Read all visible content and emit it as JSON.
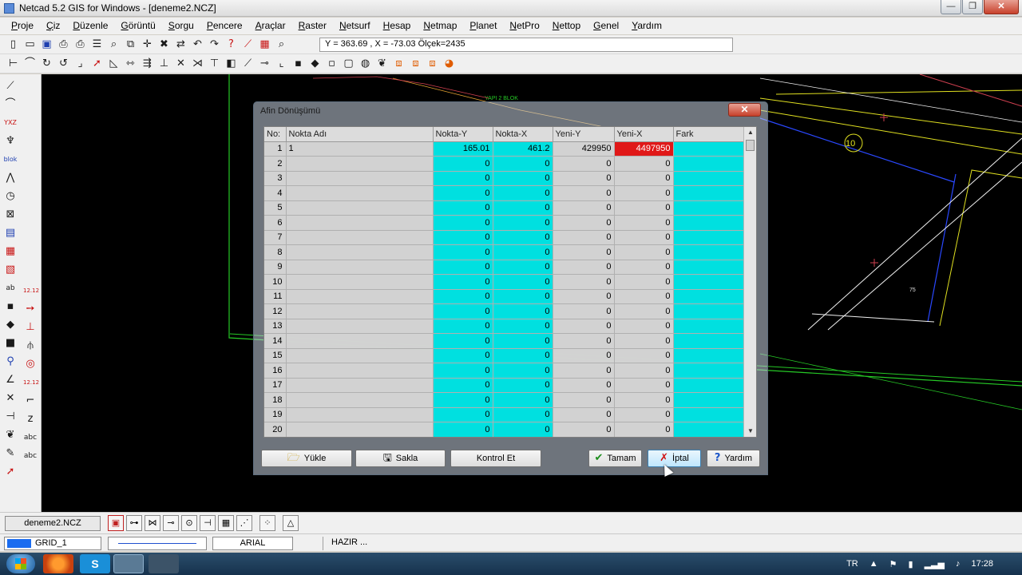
{
  "window": {
    "title": "Netcad 5.2 GIS for Windows - [deneme2.NCZ]",
    "minimize": "—",
    "maximize": "❐",
    "close": "✕"
  },
  "menu": [
    "Proje",
    "Çiz",
    "Düzenle",
    "Görüntü",
    "Sorgu",
    "Pencere",
    "Araçlar",
    "Raster",
    "Netsurf",
    "Hesap",
    "Netmap",
    "Planet",
    "NetPro",
    "Nettop",
    "Genel",
    "Yardım"
  ],
  "coord_readout": "Y = 363.69 , X = -73.03  Ölçek=2435",
  "left_toolbar": {
    "yxz_label": "YXZ",
    "blok_label": "blok",
    "ab_label": "ab",
    "num_label_1": "12.12",
    "num_label_2": "12.12",
    "abc_label_1": "abc",
    "abc_label_2": "abc"
  },
  "canvas": {
    "label_10": "10",
    "label_75": "75",
    "label_blok": "YAPI 2 BLOK"
  },
  "dialog": {
    "title": "Afin Dönüşümü",
    "close": "✕",
    "columns": [
      "No:",
      "Nokta Adı",
      "Nokta-Y",
      "Nokta-X",
      "Yeni-Y",
      "Yeni-X",
      "Fark"
    ],
    "rows": [
      {
        "no": "1",
        "name": "1",
        "nokta_y": "165.01",
        "nokta_x": "461.2",
        "yeni_y": "429950",
        "yeni_x": "4497950",
        "fark": ""
      },
      {
        "no": "2",
        "name": "",
        "nokta_y": "0",
        "nokta_x": "0",
        "yeni_y": "0",
        "yeni_x": "0",
        "fark": ""
      },
      {
        "no": "3",
        "name": "",
        "nokta_y": "0",
        "nokta_x": "0",
        "yeni_y": "0",
        "yeni_x": "0",
        "fark": ""
      },
      {
        "no": "4",
        "name": "",
        "nokta_y": "0",
        "nokta_x": "0",
        "yeni_y": "0",
        "yeni_x": "0",
        "fark": ""
      },
      {
        "no": "5",
        "name": "",
        "nokta_y": "0",
        "nokta_x": "0",
        "yeni_y": "0",
        "yeni_x": "0",
        "fark": ""
      },
      {
        "no": "6",
        "name": "",
        "nokta_y": "0",
        "nokta_x": "0",
        "yeni_y": "0",
        "yeni_x": "0",
        "fark": ""
      },
      {
        "no": "7",
        "name": "",
        "nokta_y": "0",
        "nokta_x": "0",
        "yeni_y": "0",
        "yeni_x": "0",
        "fark": ""
      },
      {
        "no": "8",
        "name": "",
        "nokta_y": "0",
        "nokta_x": "0",
        "yeni_y": "0",
        "yeni_x": "0",
        "fark": ""
      },
      {
        "no": "9",
        "name": "",
        "nokta_y": "0",
        "nokta_x": "0",
        "yeni_y": "0",
        "yeni_x": "0",
        "fark": ""
      },
      {
        "no": "10",
        "name": "",
        "nokta_y": "0",
        "nokta_x": "0",
        "yeni_y": "0",
        "yeni_x": "0",
        "fark": ""
      },
      {
        "no": "11",
        "name": "",
        "nokta_y": "0",
        "nokta_x": "0",
        "yeni_y": "0",
        "yeni_x": "0",
        "fark": ""
      },
      {
        "no": "12",
        "name": "",
        "nokta_y": "0",
        "nokta_x": "0",
        "yeni_y": "0",
        "yeni_x": "0",
        "fark": ""
      },
      {
        "no": "13",
        "name": "",
        "nokta_y": "0",
        "nokta_x": "0",
        "yeni_y": "0",
        "yeni_x": "0",
        "fark": ""
      },
      {
        "no": "14",
        "name": "",
        "nokta_y": "0",
        "nokta_x": "0",
        "yeni_y": "0",
        "yeni_x": "0",
        "fark": ""
      },
      {
        "no": "15",
        "name": "",
        "nokta_y": "0",
        "nokta_x": "0",
        "yeni_y": "0",
        "yeni_x": "0",
        "fark": ""
      },
      {
        "no": "16",
        "name": "",
        "nokta_y": "0",
        "nokta_x": "0",
        "yeni_y": "0",
        "yeni_x": "0",
        "fark": ""
      },
      {
        "no": "17",
        "name": "",
        "nokta_y": "0",
        "nokta_x": "0",
        "yeni_y": "0",
        "yeni_x": "0",
        "fark": ""
      },
      {
        "no": "18",
        "name": "",
        "nokta_y": "0",
        "nokta_x": "0",
        "yeni_y": "0",
        "yeni_x": "0",
        "fark": ""
      },
      {
        "no": "19",
        "name": "",
        "nokta_y": "0",
        "nokta_x": "0",
        "yeni_y": "0",
        "yeni_x": "0",
        "fark": ""
      },
      {
        "no": "20",
        "name": "",
        "nokta_y": "0",
        "nokta_x": "0",
        "yeni_y": "0",
        "yeni_x": "0",
        "fark": ""
      }
    ],
    "buttons": {
      "yukle": "Yükle",
      "sakla": "Sakla",
      "kontrol": "Kontrol Et",
      "tamam": "Tamam",
      "iptal": "İptal",
      "yardim": "Yardım"
    }
  },
  "bottom": {
    "file_tab": "deneme2.NCZ",
    "layer": "GRID_1",
    "font": "ARIAL",
    "status": "HAZIR ..."
  },
  "taskbar": {
    "lang": "TR",
    "time": "17:28",
    "skype_letter": "S"
  },
  "colors": {
    "canvas_bg": "#000000",
    "grid_cyan": "#00e0e0",
    "selected_cell": "#e01818",
    "layer_swatch": "#1a6cf0"
  }
}
